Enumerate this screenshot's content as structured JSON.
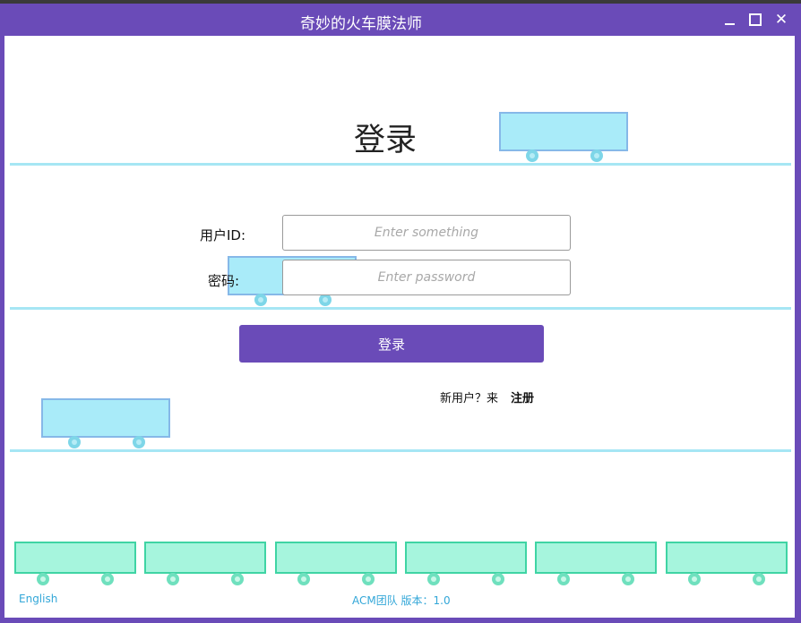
{
  "window": {
    "title": "奇妙的火车膜法师",
    "minimize_icon": "minimize-icon",
    "maximize_icon": "maximize-icon",
    "close_icon": "close-icon",
    "close_glyph": "✕"
  },
  "login": {
    "heading": "登录",
    "user_id_label": "用户ID:",
    "user_id_placeholder": "Enter something",
    "user_id_value": "",
    "password_label": "密码:",
    "password_placeholder": "Enter password",
    "password_value": "",
    "submit_label": "登录"
  },
  "register": {
    "prompt": "新用户？来",
    "link_label": "注册"
  },
  "footer": {
    "language": "English",
    "version": "ACM团队 版本：1.0"
  },
  "colors": {
    "accent": "#6a4bb8",
    "track": "#a6e6f4",
    "cart_fill": "#a9ebf9",
    "cart_border": "#86b8e8",
    "green_cart_fill": "#a6f5dd",
    "green_cart_border": "#3fd4a4",
    "footer_text": "#33a7d8"
  }
}
